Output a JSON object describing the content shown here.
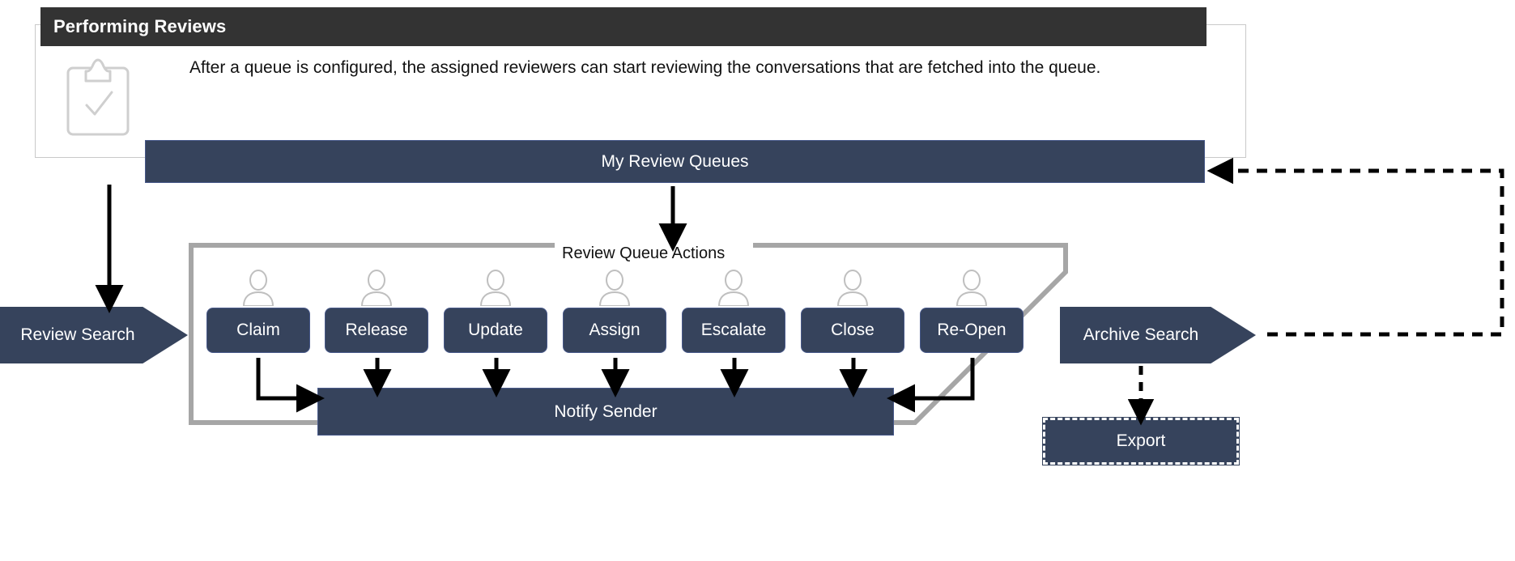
{
  "panel": {
    "title": "Performing Reviews",
    "body": "After a queue is configured, the assigned reviewers can start reviewing the conversations that are fetched into the queue.",
    "icon": "clipboard-check-icon"
  },
  "flow": {
    "queues_bar": "My Review Queues",
    "group_label": "Review Queue Actions",
    "notify_bar": "Notify Sender",
    "review_search": "Review Search",
    "archive_search": "Archive Search",
    "export": "Export"
  },
  "actions": [
    {
      "label": "Claim",
      "icon": "person-icon"
    },
    {
      "label": "Release",
      "icon": "person-icon"
    },
    {
      "label": "Update",
      "icon": "person-icon"
    },
    {
      "label": "Assign",
      "icon": "person-icon"
    },
    {
      "label": "Escalate",
      "icon": "person-icon"
    },
    {
      "label": "Close",
      "icon": "person-icon"
    },
    {
      "label": "Re-Open",
      "icon": "person-icon"
    }
  ],
  "colors": {
    "navy": "#36435c",
    "navy_border": "#48598a",
    "header_dark": "#333333",
    "group_gray": "#a6a6a6",
    "panel_outline": "#c9c9c9",
    "icon_gray": "#bfbfbf",
    "arrow_black": "#000000",
    "text_light": "#ffffff"
  }
}
